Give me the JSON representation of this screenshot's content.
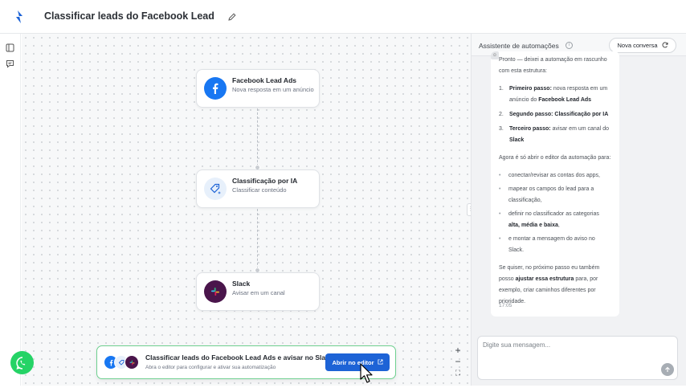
{
  "app": {
    "title": "Classificar leads do Facebook Lead Ads e avisar no Slack",
    "logo_icon": "brand-logo-icon",
    "accent_color": "#1d63d6"
  },
  "flow": {
    "nodes": [
      {
        "title": "Facebook Lead Ads",
        "subtitle": "Nova resposta em um anúncio",
        "icon": "facebook-icon",
        "color": "#1877f2"
      },
      {
        "title": "Classificação por IA",
        "subtitle": "Classificar conteúdo",
        "icon": "ai-tag-icon",
        "color": "#e7f0fb"
      },
      {
        "title": "Slack",
        "subtitle": "Avisar em um canal",
        "icon": "slack-icon",
        "color": "#4a154b"
      }
    ],
    "zoom_controls": {
      "in": "+",
      "out": "−",
      "fit": "⛶"
    }
  },
  "banner": {
    "title": "Classificar leads do Facebook Lead Ads e avisar no Slack",
    "subtitle": "Abra o editor para configurar e ativar sua automatização",
    "button_label": "Abrir no editor"
  },
  "assistant": {
    "title": "Assistente de automações",
    "new_conversation_label": "Nova conversa",
    "intro": "Pronto — deixei a automação em rascunho com esta estrutura:",
    "steps": [
      {
        "num": "1.",
        "label": "Primeiro passo:",
        "text": " nova resposta em um anúncio do ",
        "strong": "Facebook Lead Ads"
      },
      {
        "num": "2.",
        "label": "Segundo passo: Classificação por IA",
        "text": "",
        "strong": ""
      },
      {
        "num": "3.",
        "label": "Terceiro passo:",
        "text": " avisar em um canal do ",
        "strong": "Slack"
      }
    ],
    "next_intro": "Agora é só abrir o editor da automação para:",
    "bullets": [
      {
        "text": "conectar/revisar as contas dos apps,",
        "strong": ""
      },
      {
        "text": "mapear os campos do lead para a classificação,",
        "strong": ""
      },
      {
        "text": "definir no classificador as categorias ",
        "strong": "alta, média e baixa",
        "tail": ","
      },
      {
        "text": "e montar a mensagem do aviso no Slack.",
        "strong": ""
      }
    ],
    "closing_pre": "Se quiser, no próximo passo eu também posso ",
    "closing_strong": "ajustar essa estrutura",
    "closing_post": " para, por exemplo, criar caminhos diferentes por prioridade.",
    "time": "17:05",
    "input_placeholder": "Digite sua mensagem..."
  }
}
